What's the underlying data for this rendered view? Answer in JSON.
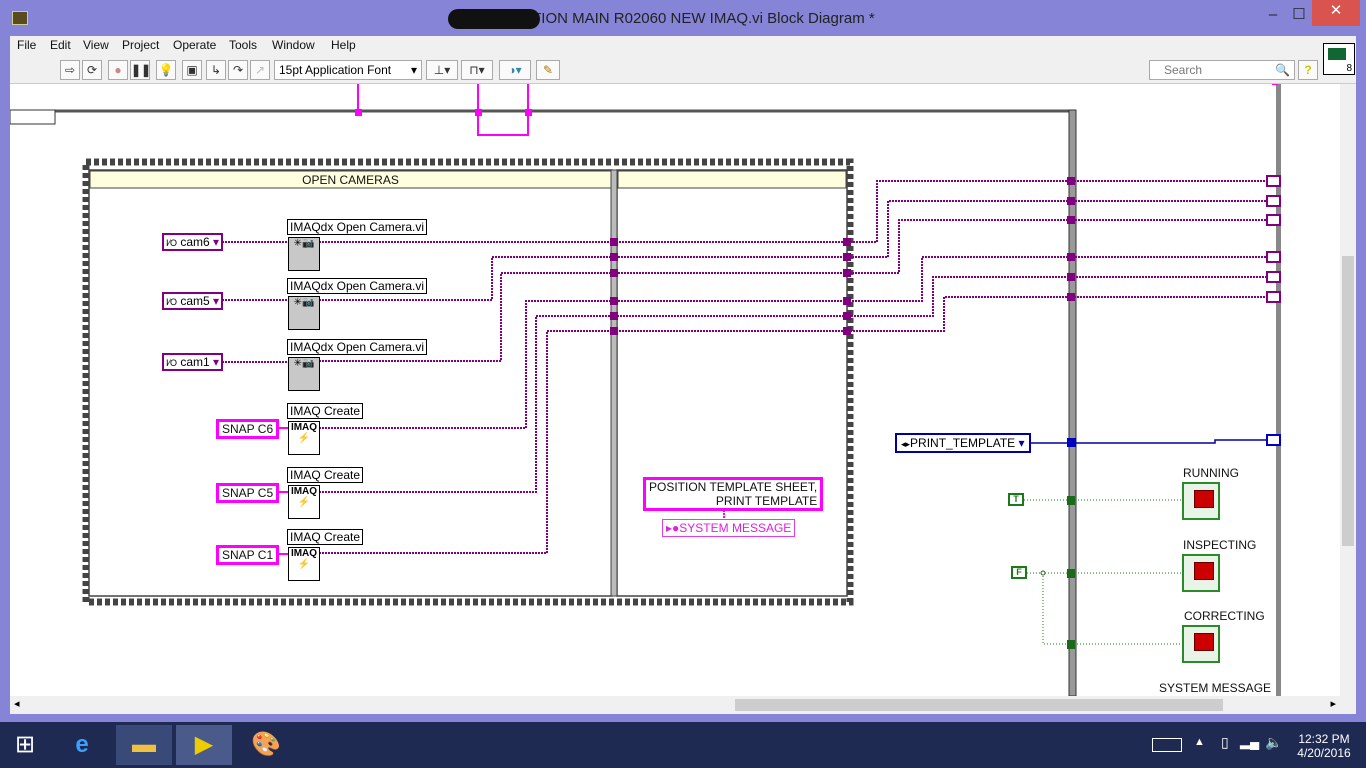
{
  "window": {
    "title": "SPECTION MAIN R02060 NEW IMAQ.vi Block Diagram *",
    "minimize": "–",
    "maximize": "☐",
    "close": "✕"
  },
  "menu": [
    "File",
    "Edit",
    "View",
    "Project",
    "Operate",
    "Tools",
    "Window",
    "Help"
  ],
  "toolbar": {
    "font": "15pt Application Font",
    "search_placeholder": "Search",
    "help": "?",
    "icon_number": "8"
  },
  "sequence": {
    "frame1_title": "OPEN CAMERAS",
    "frame2_title": ""
  },
  "cameras": [
    {
      "constant": "cam6",
      "node": "IMAQdx Open Camera.vi"
    },
    {
      "constant": "cam5",
      "node": "IMAQdx Open Camera.vi"
    },
    {
      "constant": "cam1",
      "node": "IMAQdx Open Camera.vi"
    }
  ],
  "images": [
    {
      "constant": "SNAP C6",
      "node": "IMAQ Create"
    },
    {
      "constant": "SNAP C5",
      "node": "IMAQ Create"
    },
    {
      "constant": "SNAP C1",
      "node": "IMAQ Create"
    }
  ],
  "message": {
    "line1": "POSITION TEMPLATE SHEET,",
    "line2": "PRINT TEMPLATE",
    "local": "SYSTEM MESSAGE"
  },
  "state_enum": "PRINT_TEMPLATE",
  "booleans": {
    "true": "T",
    "false": "F"
  },
  "indicators": [
    "RUNNING",
    "INSPECTING",
    "CORRECTING",
    "SYSTEM MESSAGE"
  ],
  "taskbar": {
    "time": "12:32 PM",
    "date": "4/20/2016"
  },
  "colors": {
    "wire_refnum": "#800080",
    "wire_string": "#ff00ff",
    "wire_enum": "#0000a0",
    "wire_bool": "#1a7a1a",
    "titlebar": "#8584d6"
  }
}
